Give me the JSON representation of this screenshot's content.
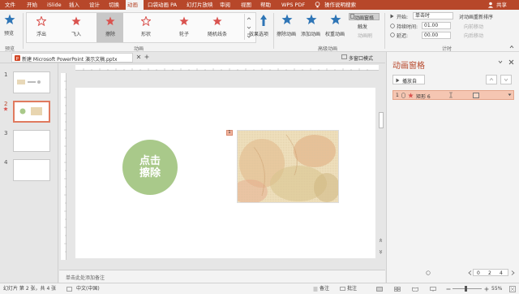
{
  "menubar": {
    "tabs": [
      {
        "label": "文件"
      },
      {
        "label": "开始"
      },
      {
        "label": "iSlide"
      },
      {
        "label": "插入"
      },
      {
        "label": "设计"
      },
      {
        "label": "切换"
      },
      {
        "label": "动画"
      },
      {
        "label": "口袋动画 PA"
      },
      {
        "label": "幻灯片放映"
      },
      {
        "label": "审阅"
      },
      {
        "label": "视图"
      },
      {
        "label": "帮助"
      },
      {
        "label": "WPS PDF"
      },
      {
        "label": "操作说明搜索"
      }
    ],
    "share_label": "共享",
    "accent": "#b7472a"
  },
  "ribbon": {
    "preview_label": "预览",
    "preview_group": "预览",
    "effects": [
      {
        "label": "浮出",
        "color": "#d9534f"
      },
      {
        "label": "飞入",
        "color": "#d9534f"
      },
      {
        "label": "擦除",
        "color": "#d9534f"
      },
      {
        "label": "形状",
        "color": "#d9534f"
      },
      {
        "label": "轮子",
        "color": "#d9534f"
      },
      {
        "label": "随机线条",
        "color": "#d9534f"
      }
    ],
    "effect_options_label": "效果选项",
    "animation_group": "动画",
    "add_animation_label": "添加动画",
    "anim_painter_label": "动画刷",
    "trigger_label": "触发",
    "anim_pane_label": "动画窗格",
    "advanced_group": "高级动画",
    "start_label": "开始:",
    "start_value": "单击时",
    "duration_label": "持续时间:",
    "duration_value": "01.00",
    "delay_label": "延迟:",
    "delay_value": "00.00",
    "reorder_label": "对动画重新排序",
    "move_earlier_label": "向前移动",
    "move_later_label": "向后移动",
    "timing_group": "计时",
    "blue_anim_label": "擦除动画",
    "blue_anim2_label": "权重动画"
  },
  "document": {
    "tab_title": "新建 Microsoft PowerPoint 演示文稿.pptx",
    "multi_window_label": "多窗口模式"
  },
  "slides": [
    {
      "num": "1"
    },
    {
      "num": "2"
    },
    {
      "num": "3"
    },
    {
      "num": "4"
    }
  ],
  "slide": {
    "circle_text_line1": "点击",
    "circle_text_line2": "擦除",
    "anim_marker": "1",
    "circle_color": "#a9c98a"
  },
  "notes_placeholder": "单击此处添加备注",
  "anim_pane": {
    "title": "动画窗格",
    "play_label": "播放自",
    "item_num": "1",
    "item_name": "矩形 6",
    "timeline_ticks": [
      "0",
      "2",
      "4"
    ]
  },
  "statusbar": {
    "slide_info": "幻灯片 第 2 张，共 4 张",
    "language": "中文(中国)",
    "notes_label": "备注",
    "comments_label": "批注",
    "zoom_value": "55%"
  }
}
